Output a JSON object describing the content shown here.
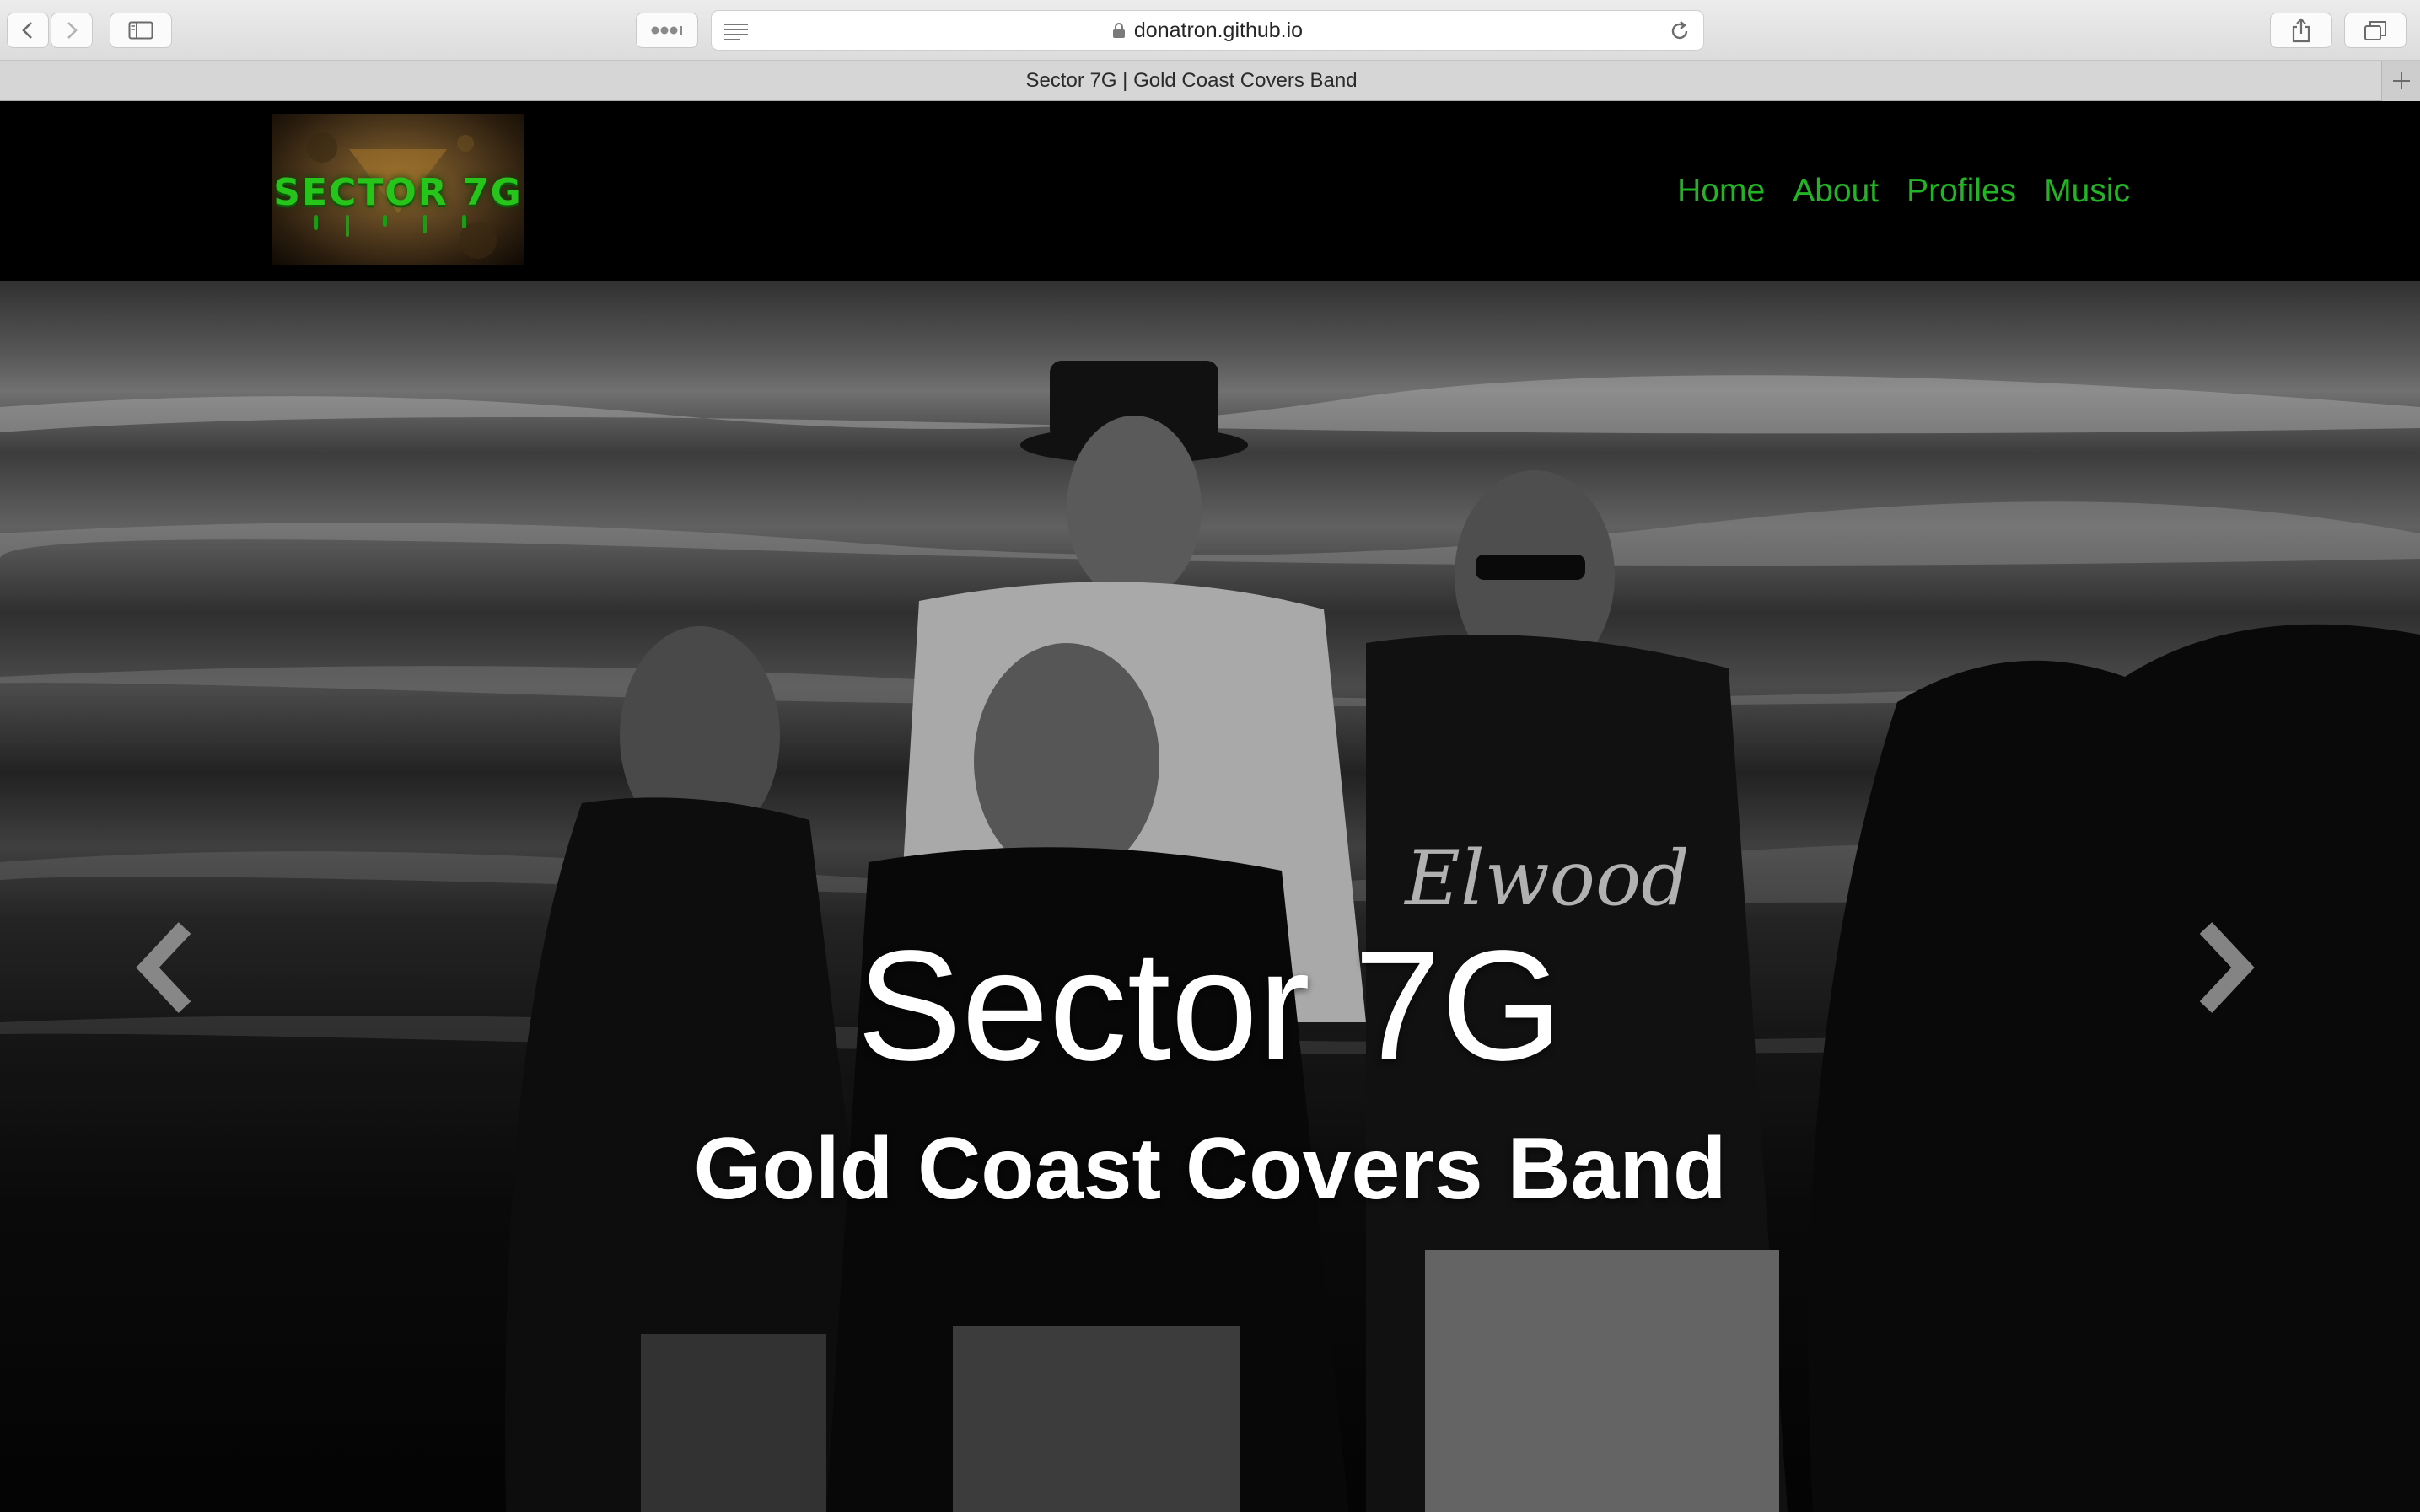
{
  "browser": {
    "url": "donatron.github.io",
    "tab_title": "Sector 7G | Gold Coast Covers Band",
    "icons": [
      "back-icon",
      "forward-icon",
      "sidebar-icon",
      "extensions-icon",
      "reader-icon",
      "lock-icon",
      "reload-icon",
      "share-icon",
      "tabs-icon",
      "new-tab-icon"
    ]
  },
  "site": {
    "logo_text": "SECTOR 7G",
    "nav": [
      {
        "label": "Home"
      },
      {
        "label": "About"
      },
      {
        "label": "Profiles"
      },
      {
        "label": "Music"
      }
    ],
    "nav_color": "#23b425"
  },
  "hero": {
    "title": "Sector 7G",
    "subtitle": "Gold Coast Covers Band",
    "prev_icon": "chevron-left-icon",
    "next_icon": "chevron-right-icon",
    "shirt_text": "Elwood"
  }
}
